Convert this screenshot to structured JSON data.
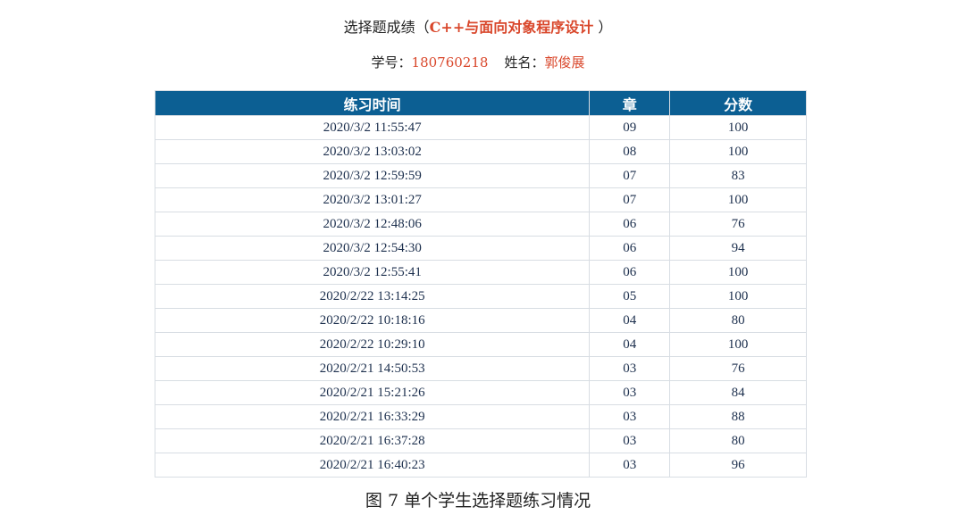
{
  "header": {
    "title_prefix": "选择题成绩（",
    "course": "C++与面向对象程序设计",
    "title_suffix": " ）",
    "student_id_label": "学号：",
    "student_id": "180760218",
    "name_label": "姓名：",
    "name": "郭俊展"
  },
  "table": {
    "columns": [
      "练习时间",
      "章",
      "分数"
    ],
    "rows": [
      [
        "2020/3/2 11:55:47",
        "09",
        "100"
      ],
      [
        "2020/3/2 13:03:02",
        "08",
        "100"
      ],
      [
        "2020/3/2 12:59:59",
        "07",
        "83"
      ],
      [
        "2020/3/2 13:01:27",
        "07",
        "100"
      ],
      [
        "2020/3/2 12:48:06",
        "06",
        "76"
      ],
      [
        "2020/3/2 12:54:30",
        "06",
        "94"
      ],
      [
        "2020/3/2 12:55:41",
        "06",
        "100"
      ],
      [
        "2020/2/22 13:14:25",
        "05",
        "100"
      ],
      [
        "2020/2/22 10:18:16",
        "04",
        "80"
      ],
      [
        "2020/2/22 10:29:10",
        "04",
        "100"
      ],
      [
        "2020/2/21 14:50:53",
        "03",
        "76"
      ],
      [
        "2020/2/21 15:21:26",
        "03",
        "84"
      ],
      [
        "2020/2/21 16:33:29",
        "03",
        "88"
      ],
      [
        "2020/2/21 16:37:28",
        "03",
        "80"
      ],
      [
        "2020/2/21 16:40:23",
        "03",
        "96"
      ]
    ]
  },
  "caption": "图 7  单个学生选择题练习情况",
  "colors": {
    "header_bg": "#0c5f93",
    "accent": "#d9472b"
  }
}
